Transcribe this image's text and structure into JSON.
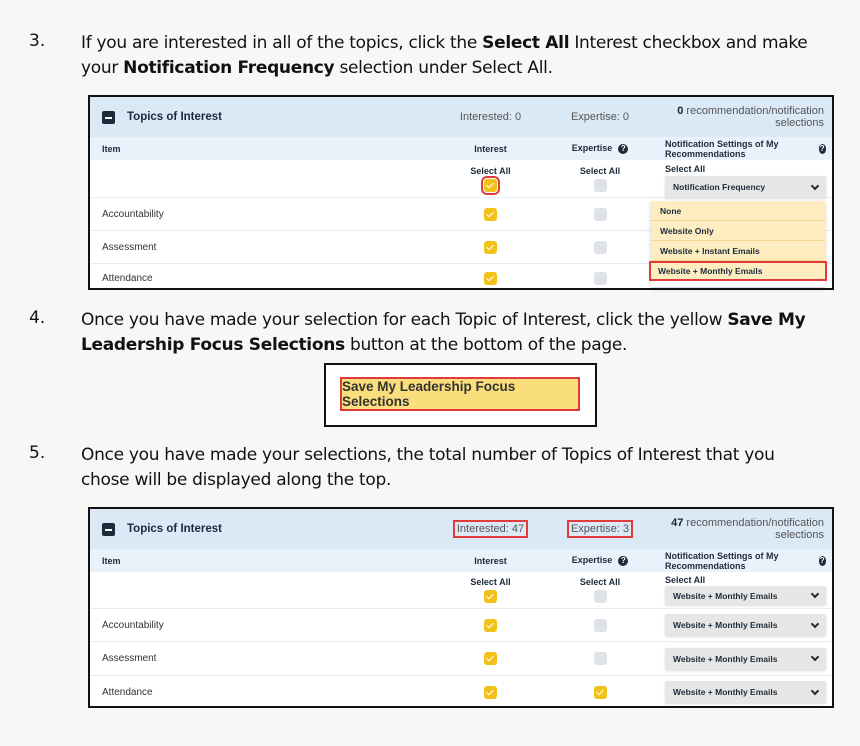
{
  "steps": [
    {
      "number": "3.",
      "text_parts": [
        {
          "t": "If you are interested in all of the topics, click the ",
          "b": false
        },
        {
          "t": "Select All",
          "b": true
        },
        {
          "t": " Interest checkbox and make your ",
          "b": false
        },
        {
          "t": "Notification Frequency",
          "b": true
        },
        {
          "t": " selection under Select All.",
          "b": false
        }
      ]
    },
    {
      "number": "4.",
      "text_parts": [
        {
          "t": "Once you have made your selection for each Topic of Interest, click the yellow ",
          "b": false
        },
        {
          "t": "Save My Leadership Focus Selections",
          "b": true
        },
        {
          "t": " button at the bottom of the page.",
          "b": false
        }
      ]
    },
    {
      "number": "5.",
      "text_parts": [
        {
          "t": "Once you have made your selections, the total number of Topics of Interest that you chose will be displayed along the top.",
          "b": false
        }
      ]
    }
  ],
  "screenshot1": {
    "section_title": "Topics of Interest",
    "interested": "Interested: 0",
    "expertise": "Expertise: 0",
    "recs_count": "0",
    "recs_label": " recommendation/notification selections",
    "columns": {
      "item": "Item",
      "interest": "Interest",
      "expertise": "Expertise",
      "notification": "Notification Settings of My Recommendations"
    },
    "select_all": "Select All",
    "select_all_interest_checked": true,
    "select_all_expertise_checked": false,
    "dropdown_value": "Notification Frequency",
    "dropdown_options": [
      "None",
      "Website Only",
      "Website + Instant Emails",
      "Website + Monthly Emails"
    ],
    "highlighted_option": "Website + Monthly Emails",
    "rows": [
      {
        "item": "Accountability",
        "interest": true,
        "expertise": false
      },
      {
        "item": "Assessment",
        "interest": true,
        "expertise": false
      },
      {
        "item": "Attendance",
        "interest": true,
        "expertise": false
      }
    ]
  },
  "save_button": {
    "label": "Save My Leadership Focus Selections"
  },
  "screenshot2": {
    "section_title": "Topics of Interest",
    "interested": "Interested: 47",
    "expertise": "Expertise: 3",
    "recs_count": "47",
    "recs_label": " recommendation/notification selections",
    "columns": {
      "item": "Item",
      "interest": "Interest",
      "expertise": "Expertise",
      "notification": "Notification Settings of My Recommendations"
    },
    "select_all": "Select All",
    "select_all_interest_checked": true,
    "select_all_expertise_checked": false,
    "select_all_notification": "Website + Monthly Emails",
    "rows": [
      {
        "item": "Accountability",
        "interest": true,
        "expertise": false,
        "notification": "Website + Monthly Emails"
      },
      {
        "item": "Assessment",
        "interest": true,
        "expertise": false,
        "notification": "Website + Monthly Emails"
      },
      {
        "item": "Attendance",
        "interest": true,
        "expertise": true,
        "notification": "Website + Monthly Emails"
      }
    ]
  },
  "colors": {
    "accent_yellow": "#f3c21a",
    "highlight_red": "#e23b3b",
    "header_blue": "#dbe9f7",
    "save_button_bg": "#fbde7c",
    "dropdown_option_bg": "#fdedc0"
  }
}
